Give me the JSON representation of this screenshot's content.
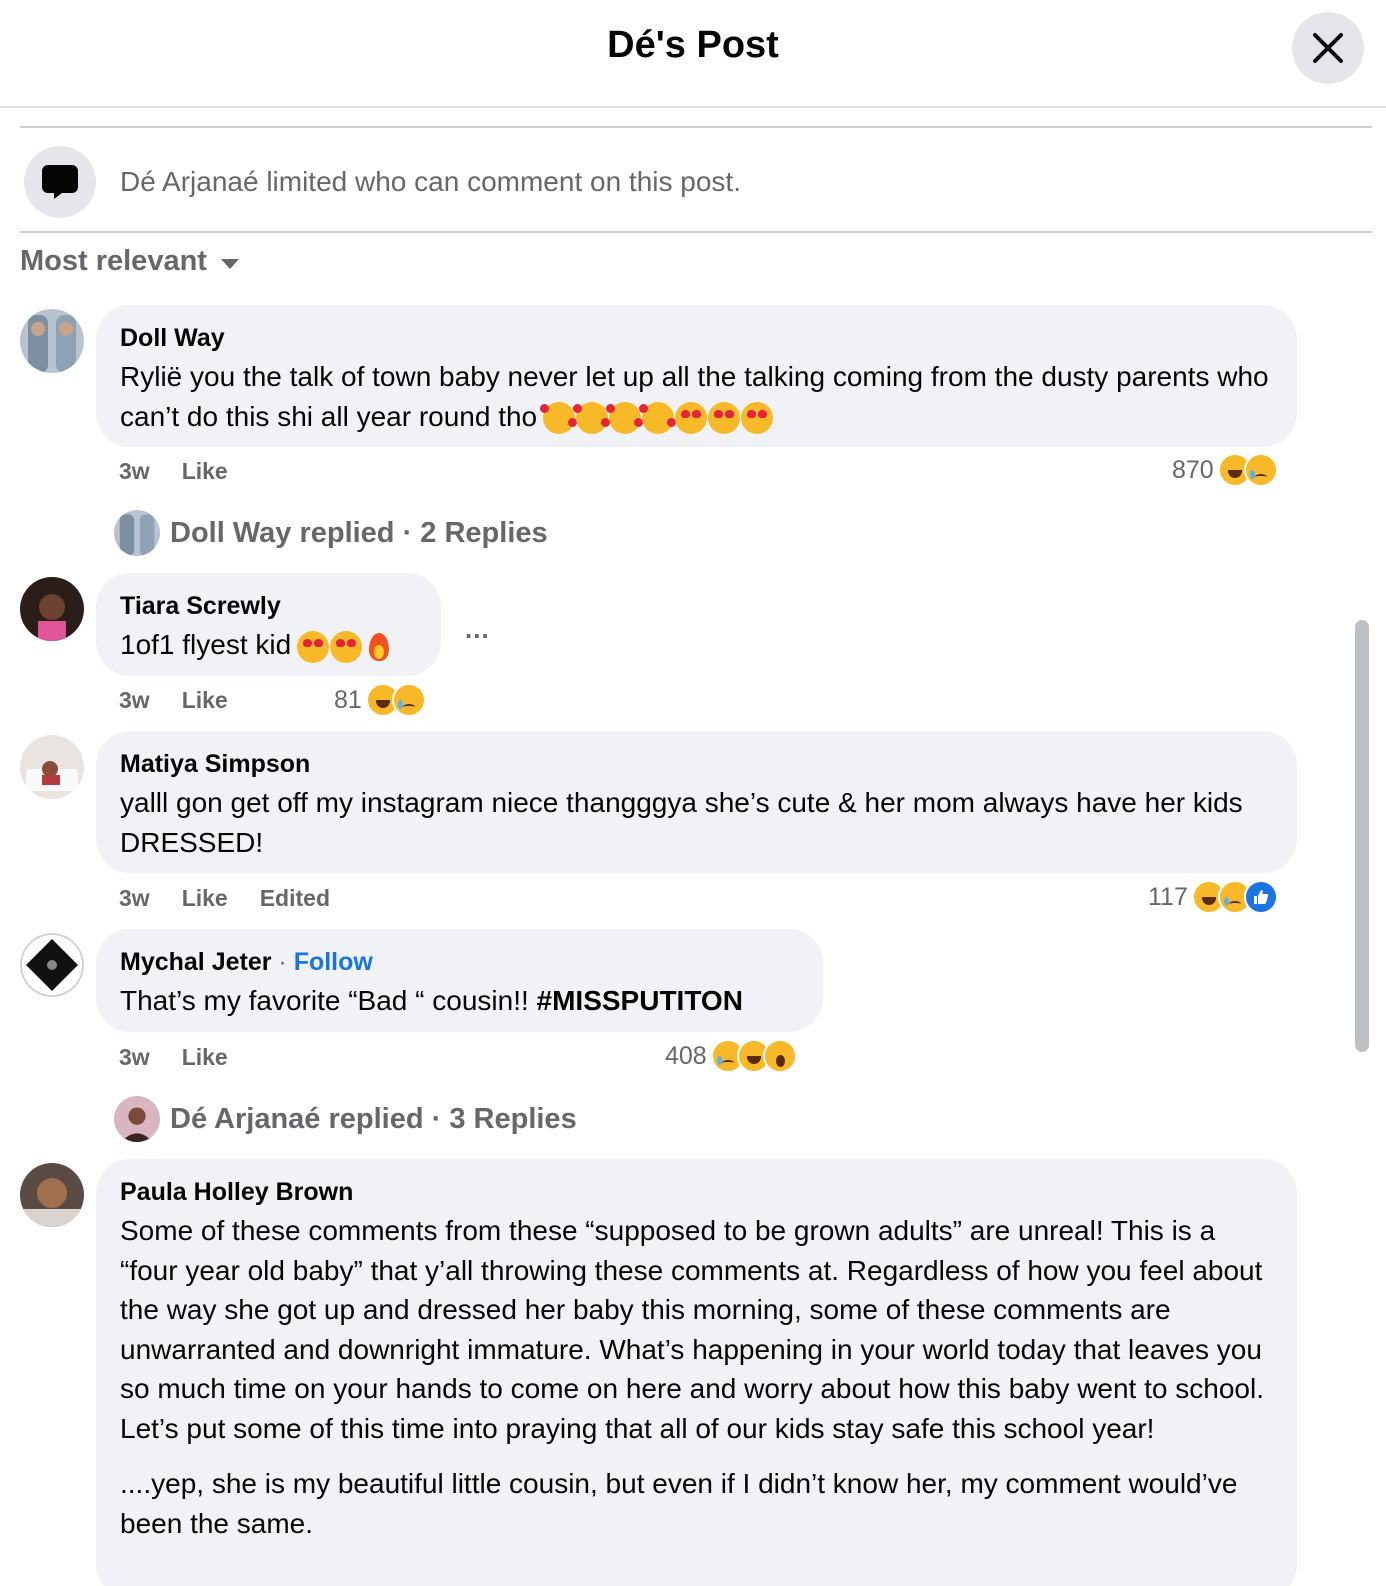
{
  "header": {
    "title": "Dé's Post"
  },
  "notice": {
    "text": "Dé Arjanaé limited who can comment on this post."
  },
  "sort": {
    "label": "Most relevant"
  },
  "comments": [
    {
      "author": "Doll Way",
      "text": "Rylië you the talk of town baby never let up all the talking coming from the dusty parents who can’t do this shi all year round tho",
      "emojis": [
        "smiling-face-with-hearts",
        "smiling-face-with-hearts",
        "smiling-face-with-hearts",
        "smiling-face-with-hearts",
        "heart-eyes",
        "heart-eyes",
        "heart-eyes"
      ],
      "time": "3w",
      "like": "Like",
      "reaction_count": "870",
      "reactions": [
        "haha",
        "sad"
      ],
      "replies": {
        "text": "Doll Way replied · 2 Replies"
      }
    },
    {
      "author": "Tiara Screwly",
      "text": "1of1 flyest kid",
      "emojis": [
        "heart-eyes",
        "heart-eyes",
        "fire"
      ],
      "time": "3w",
      "like": "Like",
      "reaction_count": "81",
      "reactions": [
        "haha",
        "sad"
      ],
      "more": "..."
    },
    {
      "author": "Matiya Simpson",
      "text": "yalll gon get off my instagram niece thangggya she’s cute & her mom always have her kids DRESSED!",
      "time": "3w",
      "like": "Like",
      "edited": "Edited",
      "reaction_count": "117",
      "reactions": [
        "haha",
        "sad",
        "like"
      ]
    },
    {
      "author": "Mychal Jeter",
      "follow": "Follow",
      "text": "That’s my favorite “Bad “ cousin!!",
      "hashtag": "#MISSPUTITON",
      "time": "3w",
      "like": "Like",
      "reaction_count": "408",
      "reactions": [
        "sad",
        "haha",
        "wow"
      ],
      "replies": {
        "text": "Dé Arjanaé replied · 3 Replies"
      }
    },
    {
      "author": "Paula Holley Brown",
      "text": "Some of these comments from these “supposed to be grown adults” are unreal! This is a “four year old baby” that y’all throwing these comments at. Regardless of how you feel about the way she got up and dressed her baby this morning, some of these comments are unwarranted and downright immature. What’s happening in your world today that leaves you so much time on your hands to come on here and worry about how this baby went to school. Let’s put some of this time into praying that all of our kids stay safe this school year!",
      "text2": "....yep, she is my beautiful little cousin, but even if I didn’t know her, my comment would’ve been the same."
    }
  ],
  "colors": {
    "link": "#1b74e4",
    "bubble": "#f0f2f5",
    "secondary": "#65676b"
  }
}
